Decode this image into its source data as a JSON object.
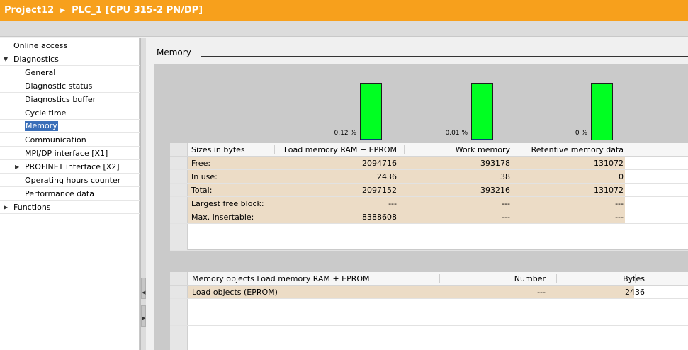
{
  "titlebar": {
    "project": "Project12",
    "device": "PLC_1 [CPU 315-2 PN/DP]"
  },
  "nav": {
    "items": [
      {
        "label": "Online access",
        "level": 0,
        "expander": ""
      },
      {
        "label": "Diagnostics",
        "level": 0,
        "expander": "expanded"
      },
      {
        "label": "General",
        "level": 1,
        "expander": ""
      },
      {
        "label": "Diagnostic status",
        "level": 1,
        "expander": ""
      },
      {
        "label": "Diagnostics buffer",
        "level": 1,
        "expander": ""
      },
      {
        "label": "Cycle time",
        "level": 1,
        "expander": ""
      },
      {
        "label": "Memory",
        "level": 1,
        "expander": "",
        "selected": true
      },
      {
        "label": "Communication",
        "level": 1,
        "expander": ""
      },
      {
        "label": "MPI/DP interface [X1]",
        "level": 1,
        "expander": ""
      },
      {
        "label": "PROFINET interface [X2]",
        "level": 1,
        "expander": "collapsed"
      },
      {
        "label": "Operating hours counter",
        "level": 1,
        "expander": ""
      },
      {
        "label": "Performance data",
        "level": 1,
        "expander": ""
      },
      {
        "label": "Functions",
        "level": 0,
        "expander": "collapsed"
      }
    ]
  },
  "memory": {
    "title": "Memory",
    "usage": [
      {
        "percent_label": "0.12 %",
        "fraction_used": 0.0012
      },
      {
        "percent_label": "0.01 %",
        "fraction_used": 0.0001
      },
      {
        "percent_label": "0 %",
        "fraction_used": 0
      }
    ],
    "colors": {
      "free": "#00ff22",
      "used": "#0a3a7a",
      "row_shade": "#ecdcc6",
      "title_bar": "#f7a01c"
    },
    "sizes_table": {
      "headers": [
        "Sizes in bytes",
        "Load memory RAM + EPROM",
        "Work memory",
        "Retentive memory data"
      ],
      "rows": [
        [
          "Free:",
          "2094716",
          "393178",
          "131072"
        ],
        [
          "In use:",
          "2436",
          "38",
          "0"
        ],
        [
          "Total:",
          "2097152",
          "393216",
          "131072"
        ],
        [
          "Largest free block:",
          "---",
          "---",
          "---"
        ],
        [
          "Max. insertable:",
          "8388608",
          "---",
          "---"
        ]
      ]
    },
    "objects_table": {
      "headers": [
        "Memory objects Load memory RAM + EPROM",
        "Number",
        "Bytes"
      ],
      "rows": [
        [
          "Load objects (EPROM)",
          "---",
          "2436"
        ]
      ]
    }
  }
}
